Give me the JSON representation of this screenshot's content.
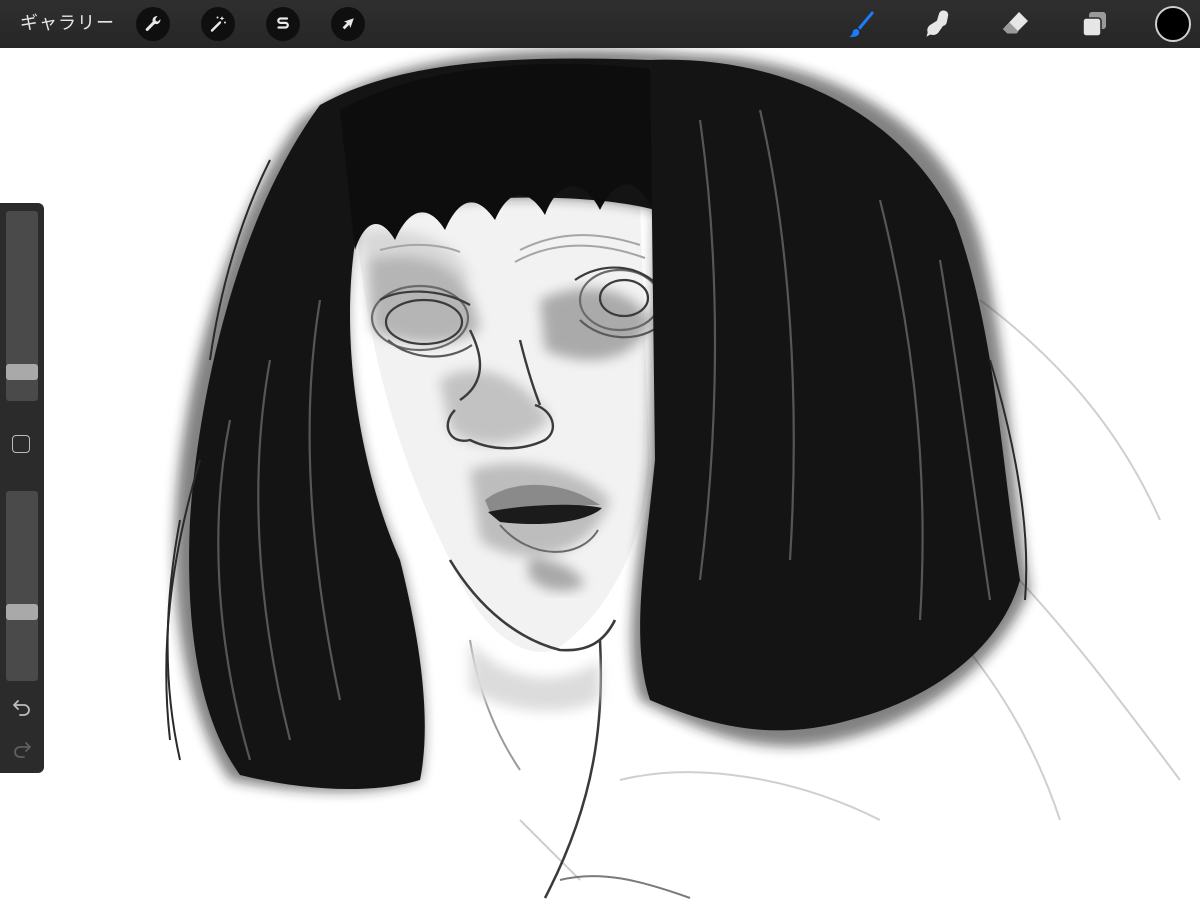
{
  "toolbar": {
    "gallery_label": "ギャラリー",
    "left_tools": [
      {
        "name": "wrench-icon"
      },
      {
        "name": "magic-wand-icon"
      },
      {
        "name": "selection-s-icon"
      },
      {
        "name": "transform-arrow-icon"
      }
    ],
    "right_tools": [
      {
        "name": "brush-icon",
        "active": true
      },
      {
        "name": "smudge-icon"
      },
      {
        "name": "eraser-icon"
      },
      {
        "name": "layers-icon"
      }
    ],
    "current_color": "#000000"
  },
  "sidebar": {
    "brush_size_slider": {
      "level": 0.12
    },
    "opacity_slider": {
      "level": 0.35
    },
    "modify_button_icon": "square-icon",
    "undo_icon": "undo-icon",
    "redo_icon": "redo-icon"
  },
  "colors": {
    "toolbar_bg": "#2b2b2b",
    "accent_blue": "#1e7bff",
    "canvas_bg": "#ffffff"
  }
}
